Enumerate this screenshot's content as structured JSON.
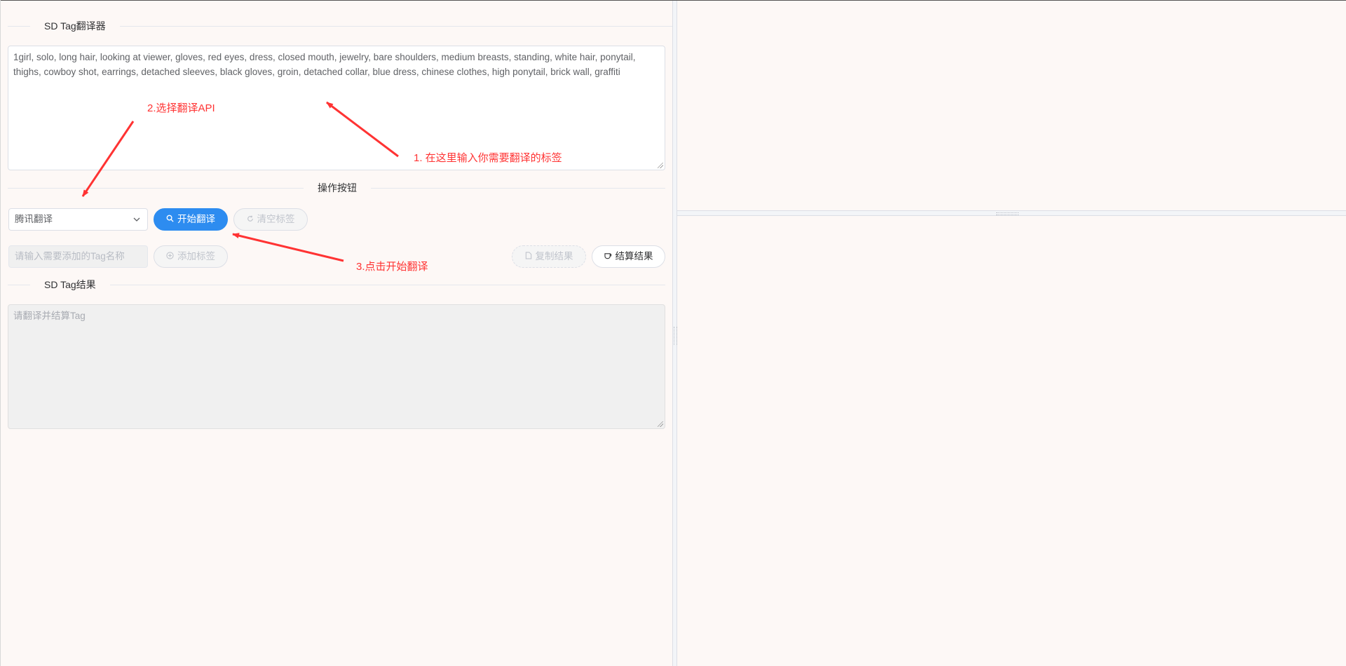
{
  "translator": {
    "section_title": "SD Tag翻译器",
    "input_text": "1girl, solo, long hair, looking at viewer, gloves, red eyes, dress, closed mouth, jewelry, bare shoulders, medium breasts, standing, white hair, ponytail, thighs, cowboy shot, earrings, detached sleeves, black gloves, groin, detached collar, blue dress,  chinese clothes, high ponytail, brick wall, graffiti"
  },
  "actions": {
    "section_title": "操作按钮",
    "api_select_value": "腾讯翻译",
    "start_button": "开始翻译",
    "clear_button": "清空标签",
    "tag_input_placeholder": "请输入需要添加的Tag名称",
    "add_button": "添加标签",
    "copy_button": "复制结果",
    "compute_button": "结算结果"
  },
  "result": {
    "section_title": "SD Tag结果",
    "placeholder": "请翻译并结算Tag"
  },
  "annotations": {
    "step1": "1. 在这里输入你需要翻译的标签",
    "step2": "2.选择翻译API",
    "step3": "3.点击开始翻译"
  },
  "colors": {
    "primary": "#2d8cf0",
    "annotation": "#ff3333",
    "background": "#fdf8f6"
  },
  "icons": {
    "select": "chevron-down-icon",
    "start": "search-icon",
    "clear": "refresh-icon",
    "add": "plus-circle-icon",
    "copy": "document-icon",
    "compute": "cup-icon"
  }
}
